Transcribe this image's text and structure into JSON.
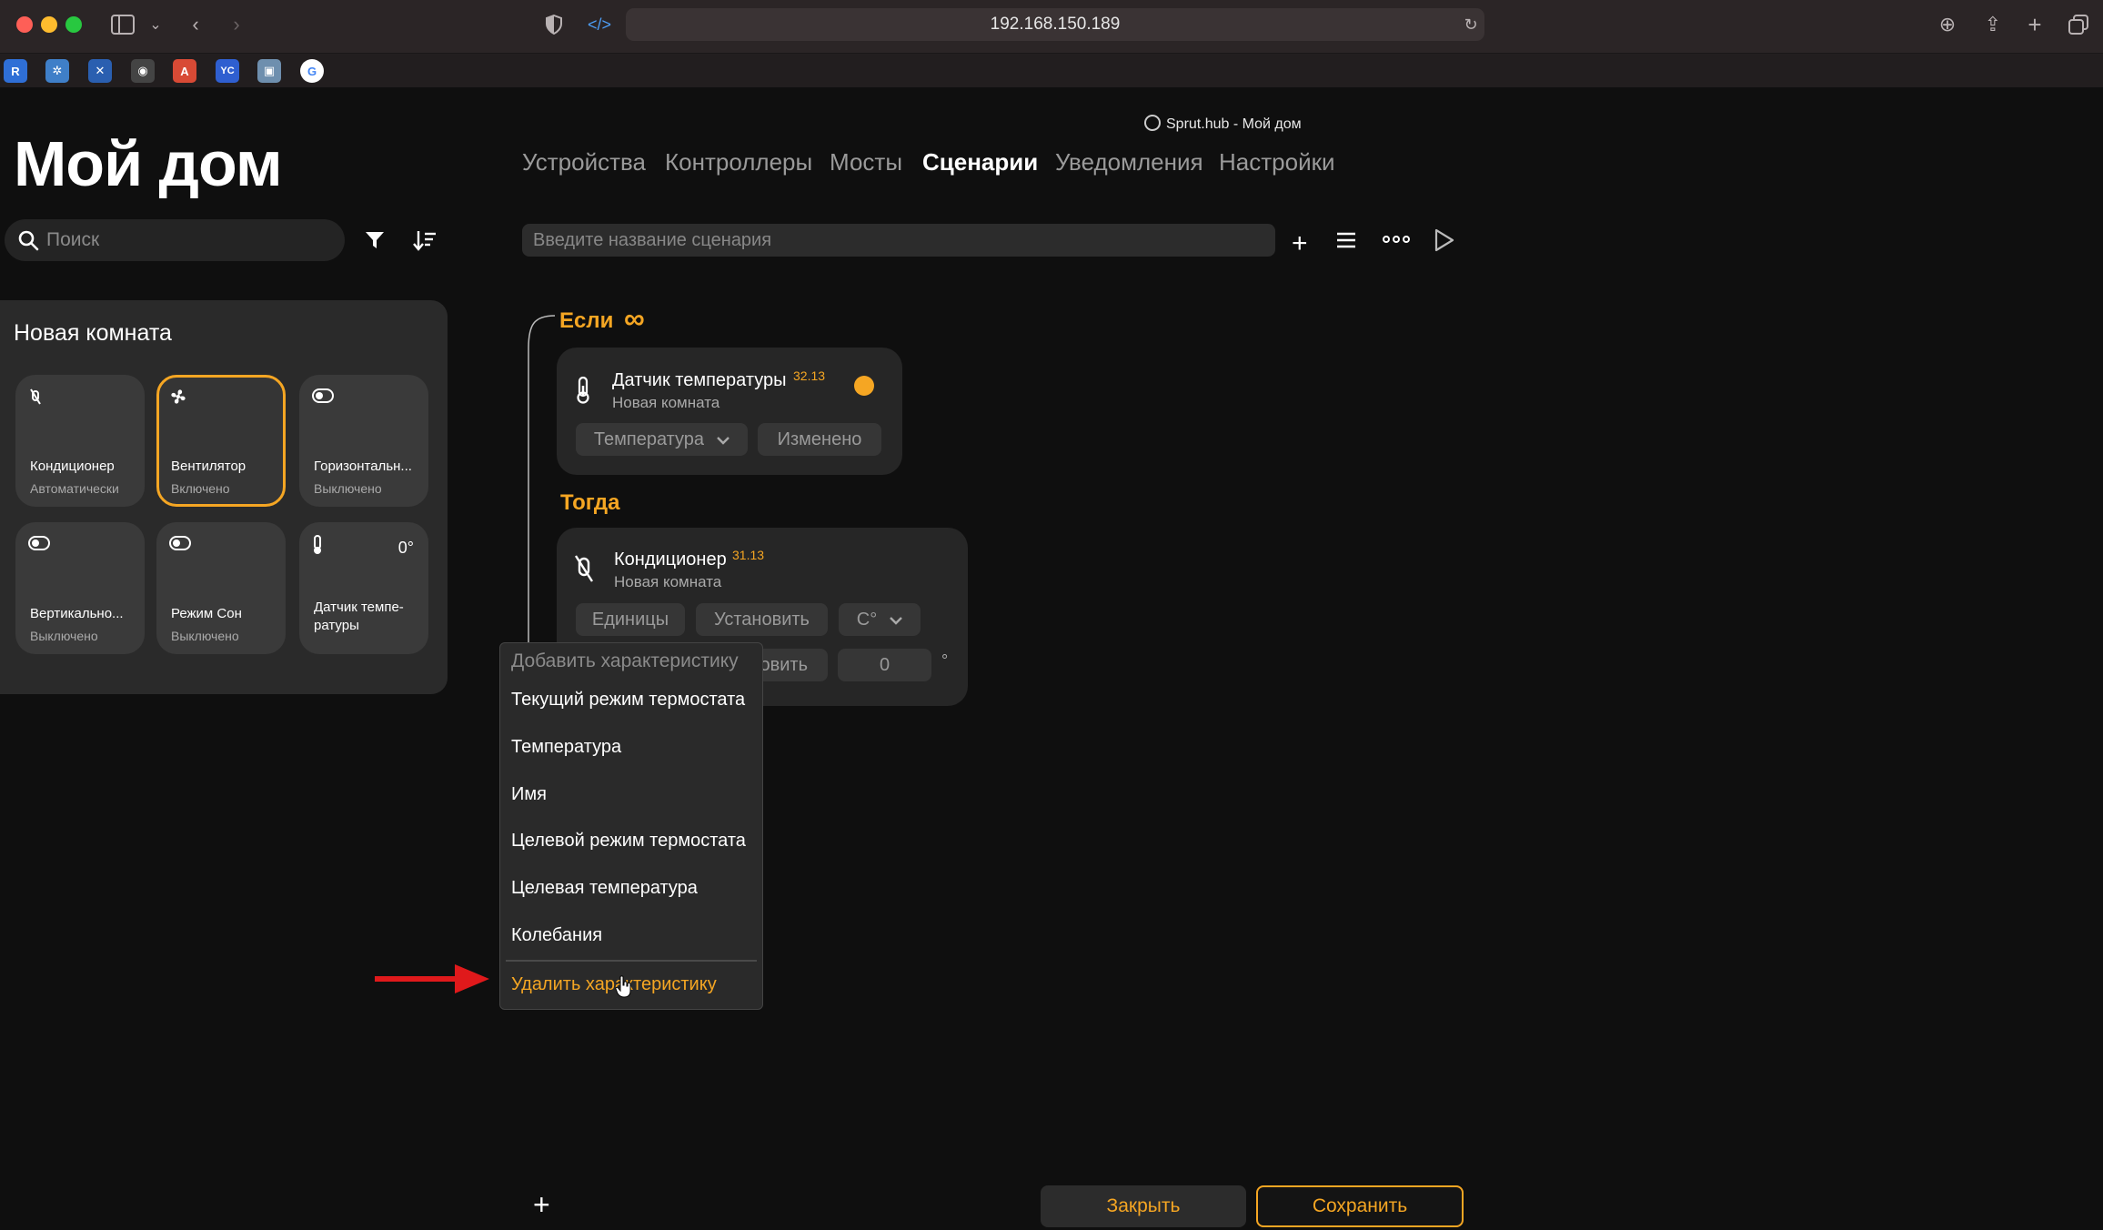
{
  "browser": {
    "address": "192.168.150.189",
    "tab_title": "Sprut.hub - Мой дом",
    "bookmarks": [
      {
        "label": "R",
        "color": "#2f6fd6"
      },
      {
        "label": "✲",
        "color": "#3f7fc8"
      },
      {
        "label": "✕",
        "color": "#2a5fb0"
      },
      {
        "label": "◉",
        "color": "#444444"
      },
      {
        "label": "A",
        "color": "#d84a35"
      },
      {
        "label": "YC",
        "color": "#2f5fd0"
      },
      {
        "label": "▣",
        "color": "#6e8fae"
      },
      {
        "label": "G",
        "color": "#ffffff"
      }
    ]
  },
  "app": {
    "title": "Мой дом",
    "search_placeholder": "Поиск",
    "nav": [
      {
        "label": "Устройства",
        "active": false
      },
      {
        "label": "Контроллеры",
        "active": false
      },
      {
        "label": "Мосты",
        "active": false
      },
      {
        "label": "Сценарии",
        "active": true
      },
      {
        "label": "Уведомления",
        "active": false
      },
      {
        "label": "Настройки",
        "active": false
      }
    ],
    "scenario_placeholder": "Введите название сценария"
  },
  "room": {
    "title": "Новая комната",
    "tiles": [
      {
        "icon": "air-conditioner-icon",
        "name": "Кондиционер",
        "state": "Автоматически",
        "active": false
      },
      {
        "icon": "fan-icon",
        "name": "Вентилятор",
        "state": "Включено",
        "active": true
      },
      {
        "icon": "toggle-icon",
        "name": "Горизонтальн...",
        "state": "Выключено",
        "active": false
      },
      {
        "icon": "toggle-icon",
        "name": "Вертикально...",
        "state": "Выключено",
        "active": false
      },
      {
        "icon": "toggle-icon",
        "name": "Режим Сон",
        "state": "Выключено",
        "active": false
      },
      {
        "icon": "thermometer-icon",
        "name": "Датчик темпе-ратуры",
        "state": "",
        "value": "0°",
        "active": false
      }
    ]
  },
  "scenario": {
    "if_label": "Если",
    "infinity": "∞",
    "if_card": {
      "name": "Датчик температуры",
      "id": "32.13",
      "room": "Новая комната",
      "characteristic": "Температура",
      "condition": "Изменено",
      "status_color": "#f5a623"
    },
    "then_label": "Тогда",
    "then_card": {
      "name": "Кондиционер",
      "id": "31.13",
      "room": "Новая комната",
      "row1": [
        "Единицы",
        "Установить",
        "C°"
      ],
      "row2_partial": "овить",
      "row2_value": "0",
      "row2_unit": "°"
    }
  },
  "menu": {
    "header": "Добавить характеристику",
    "items": [
      "Текущий режим термостата",
      "Температура",
      "Имя",
      "Целевой режим термостата",
      "Целевая температура",
      "Колебания"
    ],
    "danger_item": "Удалить характеристику"
  },
  "footer": {
    "close": "Закрыть",
    "save": "Сохранить",
    "add": "+"
  },
  "colors": {
    "accent": "#f5a623",
    "arrow": "#e0191b"
  }
}
